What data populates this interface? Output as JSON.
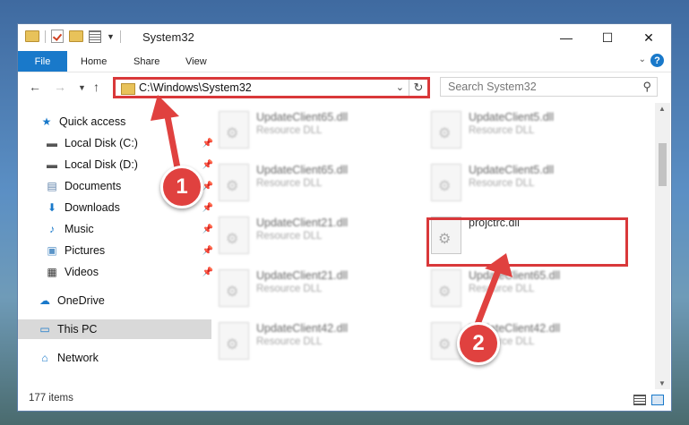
{
  "window": {
    "title": "System32",
    "minimize_glyph": "—",
    "maximize_glyph": "☐",
    "close_glyph": "✕"
  },
  "ribbon": {
    "tabs": [
      "File",
      "Home",
      "Share",
      "View"
    ],
    "help_label": "?",
    "expand_glyph": "⌄"
  },
  "address": {
    "path": "C:\\Windows\\System32",
    "search_placeholder": "Search System32"
  },
  "nav": {
    "items": [
      {
        "label": "Quick access",
        "icon": "star-icon",
        "glyph": "★",
        "color": "#1979ca"
      },
      {
        "label": "Local Disk (C:)",
        "icon": "drive-icon",
        "glyph": "▬",
        "color": "#555555",
        "pinned": true
      },
      {
        "label": "Local Disk (D:)",
        "icon": "drive-icon",
        "glyph": "▬",
        "color": "#555555",
        "pinned": true
      },
      {
        "label": "Documents",
        "icon": "document-icon",
        "glyph": "▤",
        "color": "#5b7fa8",
        "pinned": true
      },
      {
        "label": "Downloads",
        "icon": "download-icon",
        "glyph": "⬇",
        "color": "#1979ca",
        "pinned": true
      },
      {
        "label": "Music",
        "icon": "music-icon",
        "glyph": "♪",
        "color": "#1979ca",
        "pinned": true
      },
      {
        "label": "Pictures",
        "icon": "pictures-icon",
        "glyph": "▣",
        "color": "#5b95c8",
        "pinned": true
      },
      {
        "label": "Videos",
        "icon": "video-icon",
        "glyph": "▦",
        "color": "#333333",
        "pinned": true
      },
      {
        "label": "OneDrive",
        "icon": "cloud-icon",
        "glyph": "☁",
        "color": "#1979ca"
      },
      {
        "label": "This PC",
        "icon": "computer-icon",
        "glyph": "▭",
        "color": "#1979ca",
        "selected": true
      },
      {
        "label": "Network",
        "icon": "network-icon",
        "glyph": "⌂",
        "color": "#1979ca"
      }
    ]
  },
  "files": [
    {
      "name": "UpdateClient65.dll",
      "type": "Resource DLL"
    },
    {
      "name": "UpdateClient5.dll",
      "type": "Resource DLL"
    },
    {
      "name": "UpdateClient65.dll",
      "type": "Resource DLL"
    },
    {
      "name": "UpdateClient5.dll",
      "type": "Resource DLL"
    },
    {
      "name": "UpdateClient21.dll",
      "type": "Resource DLL"
    },
    {
      "name": "projctrc.dll",
      "type": ""
    },
    {
      "name": "UpdateClient21.dll",
      "type": "Resource DLL"
    },
    {
      "name": "UpdateClient65.dll",
      "type": "Resource DLL"
    },
    {
      "name": "UpdateClient42.dll",
      "type": "Resource DLL"
    },
    {
      "name": "UpdateClient42.dll",
      "type": "Resource DLL"
    }
  ],
  "status": {
    "item_count": "177 items"
  },
  "annotations": {
    "step1": "1",
    "step2": "2",
    "accent": "#e0413f"
  }
}
